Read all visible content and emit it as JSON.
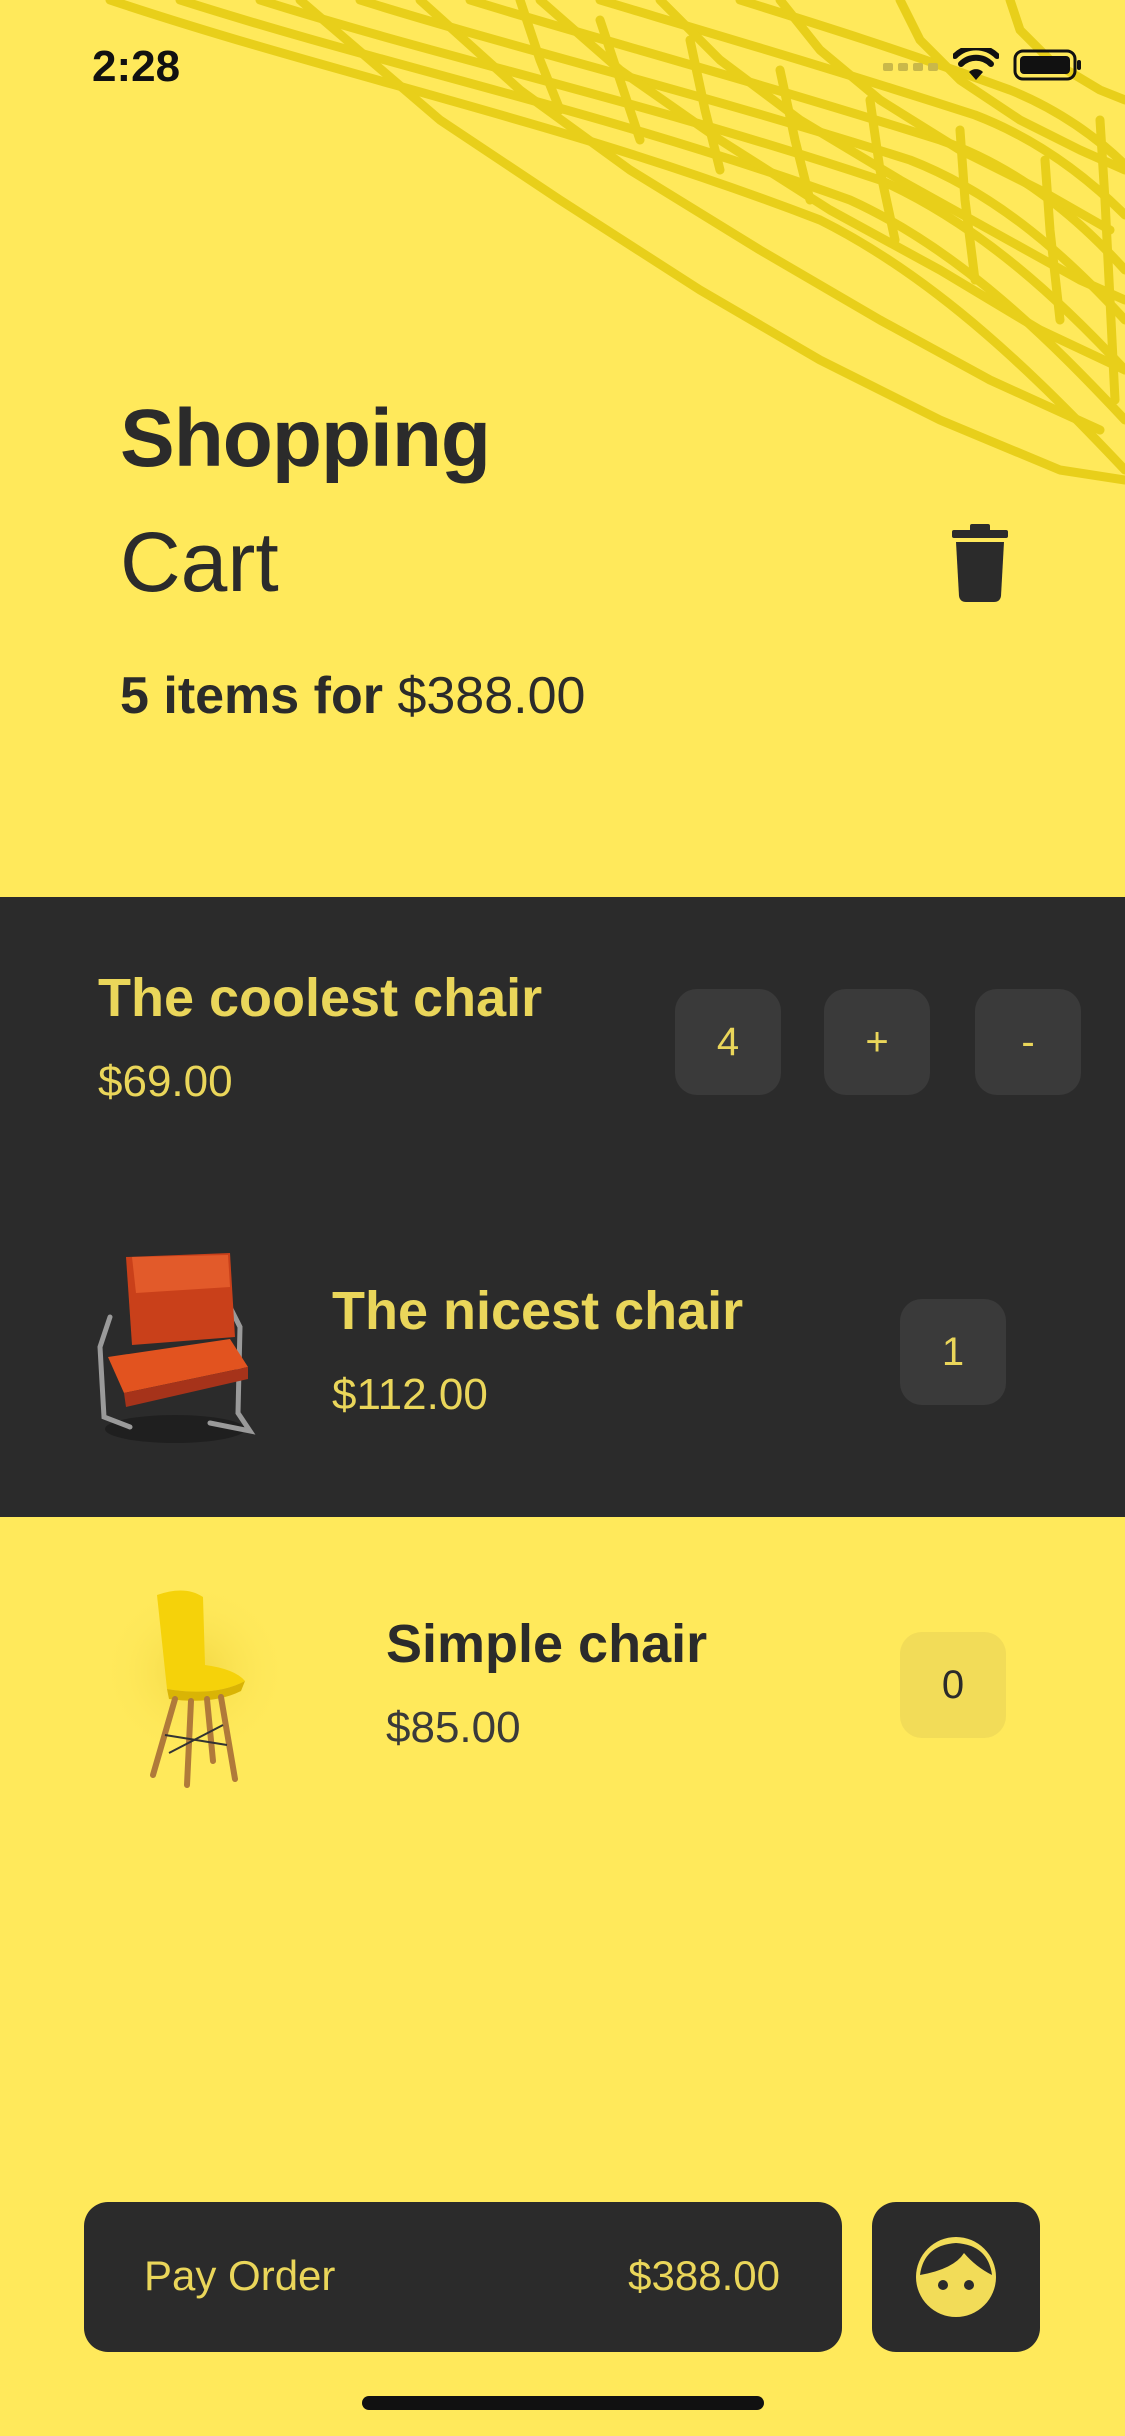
{
  "status_bar": {
    "time": "2:28",
    "icons": [
      "signal-icon",
      "wifi-icon",
      "battery-icon"
    ]
  },
  "header": {
    "title_line1": "Shopping",
    "title_line2": "Cart",
    "summary_count": "5 items for",
    "summary_price": "$388.00",
    "trash_icon": "trash-icon"
  },
  "items": [
    {
      "name": "The coolest chair",
      "price": "$69.00",
      "quantity": "4",
      "plus_label": "+",
      "minus_label": "-"
    },
    {
      "name": "The nicest chair",
      "price": "$112.00",
      "quantity": "1",
      "image_icon": "orange-chair-image"
    },
    {
      "name": "Simple chair",
      "price": "$85.00",
      "quantity": "0",
      "image_icon": "yellow-chair-image"
    }
  ],
  "footer": {
    "pay_label": "Pay Order",
    "pay_amount": "$388.00",
    "profile_icon": "face-icon"
  },
  "colors": {
    "background": "#FFE95B",
    "dark": "#2B2B2B",
    "accent_text": "#EAD65A",
    "mesh": "#E8CF1A"
  }
}
